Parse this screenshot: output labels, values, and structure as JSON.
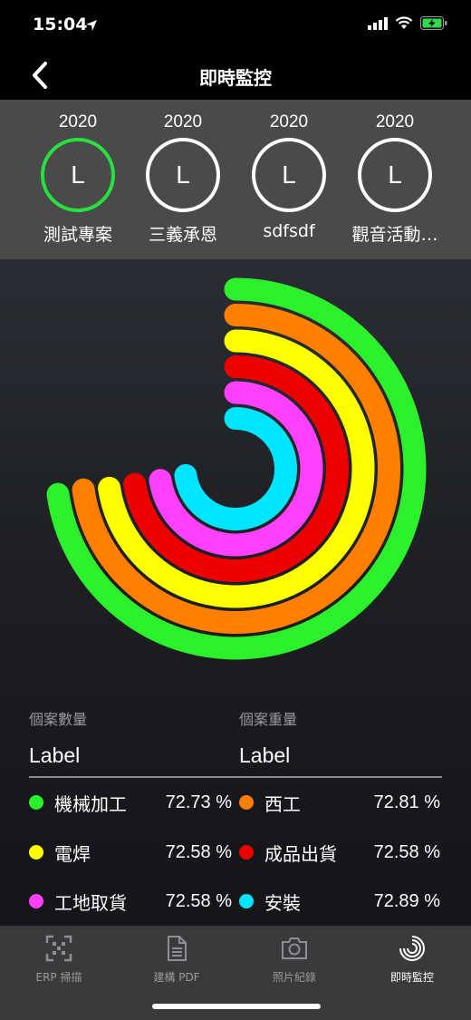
{
  "status": {
    "time": "15:04"
  },
  "nav": {
    "title": "即時監控"
  },
  "projects": [
    {
      "year": "2020",
      "initial": "L",
      "name": "測試專案",
      "active": true
    },
    {
      "year": "2020",
      "initial": "L",
      "name": "三義承恩",
      "active": false
    },
    {
      "year": "2020",
      "initial": "L",
      "name": "sdfsdf",
      "active": false
    },
    {
      "year": "2020",
      "initial": "L",
      "name": "觀音活動…",
      "active": false
    }
  ],
  "chart_data": {
    "type": "radial-bar",
    "series": [
      {
        "name": "機械加工",
        "value": 72.73,
        "color": "#2cf02c"
      },
      {
        "name": "西工",
        "value": 72.81,
        "color": "#ff8000"
      },
      {
        "name": "電焊",
        "value": 72.58,
        "color": "#ffff00"
      },
      {
        "name": "成品出貨",
        "value": 72.58,
        "color": "#ee0000"
      },
      {
        "name": "工地取貨",
        "value": 72.58,
        "color": "#ff40ff"
      },
      {
        "name": "安裝",
        "value": 72.89,
        "color": "#00e5ff"
      }
    ]
  },
  "summary": {
    "count_label": "個案數量",
    "count_value": "Label",
    "weight_label": "個案重量",
    "weight_value": "Label"
  },
  "legend": [
    {
      "name": "機械加工",
      "pct": "72.73 %",
      "color": "#2cf02c"
    },
    {
      "name": "西工",
      "pct": "72.81 %",
      "color": "#ff8000"
    },
    {
      "name": "電焊",
      "pct": "72.58 %",
      "color": "#ffff00"
    },
    {
      "name": "成品出貨",
      "pct": "72.58 %",
      "color": "#ee0000"
    },
    {
      "name": "工地取貨",
      "pct": "72.58 %",
      "color": "#ff40ff"
    },
    {
      "name": "安裝",
      "pct": "72.89 %",
      "color": "#00e5ff"
    }
  ],
  "tabs": [
    {
      "label": "ERP 掃描",
      "icon": "qr-scan-icon",
      "active": false
    },
    {
      "label": "建構 PDF",
      "icon": "document-icon",
      "active": false
    },
    {
      "label": "照片紀錄",
      "icon": "camera-icon",
      "active": false
    },
    {
      "label": "即時監控",
      "icon": "ring-chart-icon",
      "active": true
    }
  ]
}
